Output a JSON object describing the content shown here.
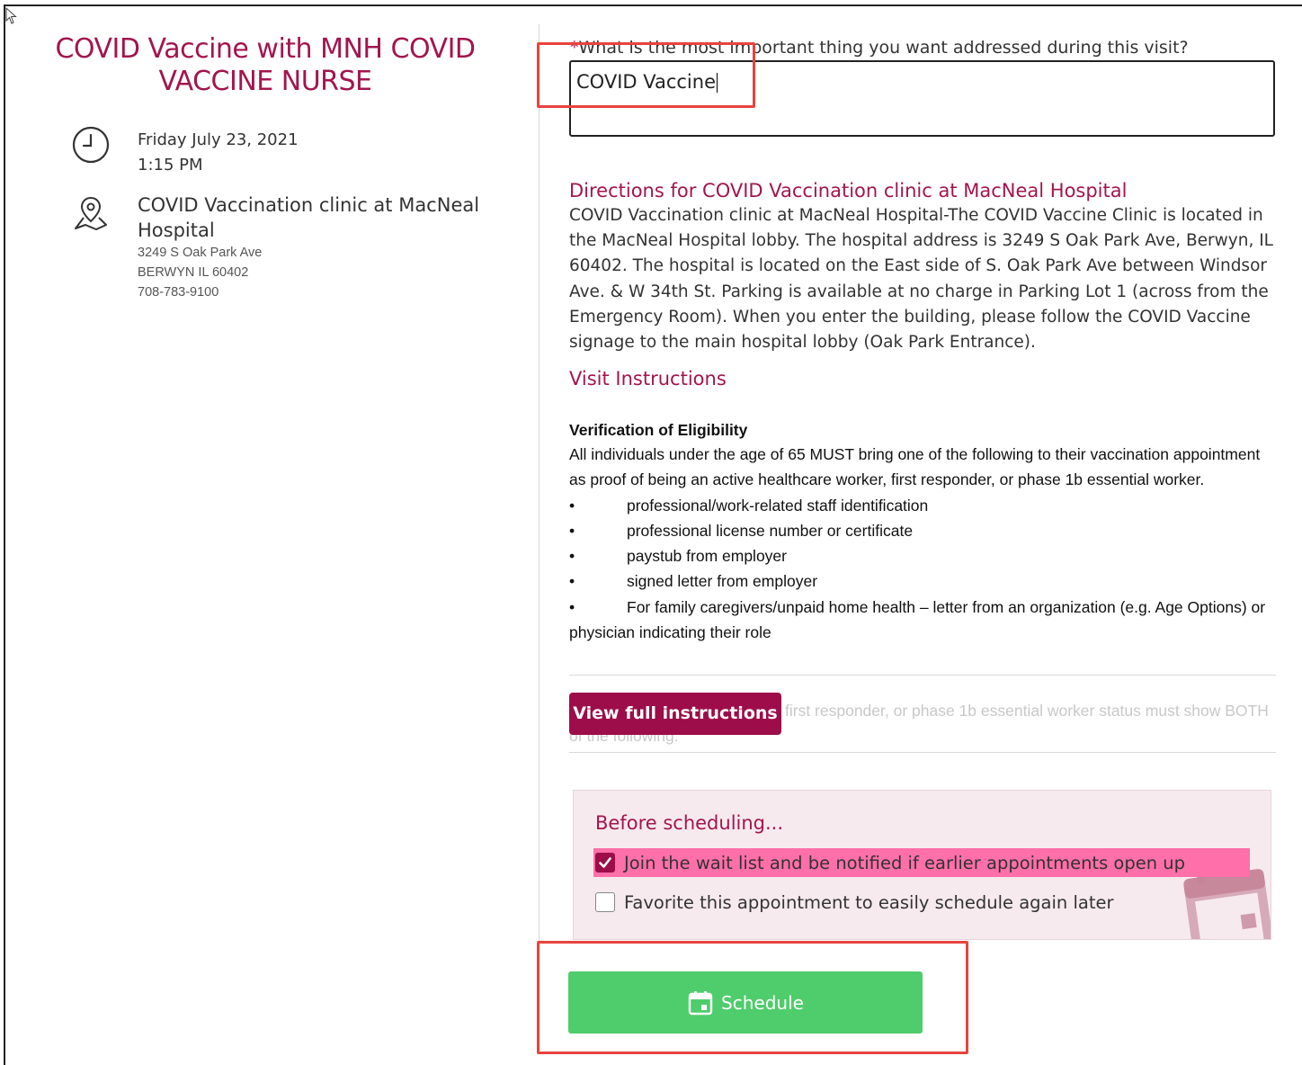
{
  "appointment": {
    "title": "COVID Vaccine with MNH COVID VACCINE NURSE",
    "date": "Friday July 23, 2021",
    "time": "1:15 PM",
    "location_name": "COVID Vaccination clinic at MacNeal Hospital",
    "address_line1": "3249 S Oak Park Ave",
    "address_line2": "BERWYN IL 60402",
    "phone": "708-783-9100"
  },
  "question": {
    "required_mark": "*",
    "label": "What is the most important thing you want addressed during this visit?",
    "value": "COVID Vaccine"
  },
  "directions": {
    "title": "Directions for COVID Vaccination clinic at MacNeal Hospital",
    "body": "COVID Vaccination clinic at MacNeal Hospital-The COVID Vaccine Clinic is located in the MacNeal Hospital lobby. The hospital address is 3249 S Oak Park Ave, Berwyn, IL 60402. The hospital is located on the East side of S. Oak Park Ave between Windsor Ave. & W 34th St. Parking is available at no charge in Parking Lot 1 (across from the Emergency Room). When you enter the building, please follow the COVID Vaccine signage to the main hospital lobby (Oak Park Entrance)."
  },
  "visit_instructions": {
    "title": "Visit Instructions",
    "heading": "Verification of Eligibility",
    "intro": "All individuals under the age of 65 MUST bring one of the following to their vaccination appointment as proof of being an active healthcare worker, first responder, or phase 1b essential worker.",
    "bullet_char": "•",
    "items": [
      "professional/work-related staff identification",
      "professional license number or certificate",
      "paystub from employer",
      "signed letter from employer",
      "For family caregivers/unpaid home health – letter from an organization (e.g. Age Options) or physician indicating their role"
    ],
    "faded_text": "first responder, or phase 1b essential worker status must show BOTH of the following:",
    "view_full_label": "View full instructions"
  },
  "before_scheduling": {
    "title": "Before scheduling...",
    "options": [
      {
        "label": "Join the wait list and be notified if earlier appointments open up",
        "checked": true
      },
      {
        "label": "Favorite this appointment to easily schedule again later",
        "checked": false
      }
    ]
  },
  "schedule_button": {
    "label": "Schedule"
  },
  "colors": {
    "brand": "#a3154e",
    "button_dark": "#9c0d4a",
    "schedule_green": "#4fcc6c",
    "highlight_pink": "#ff6fa9",
    "annotation_red": "#e8433f"
  }
}
